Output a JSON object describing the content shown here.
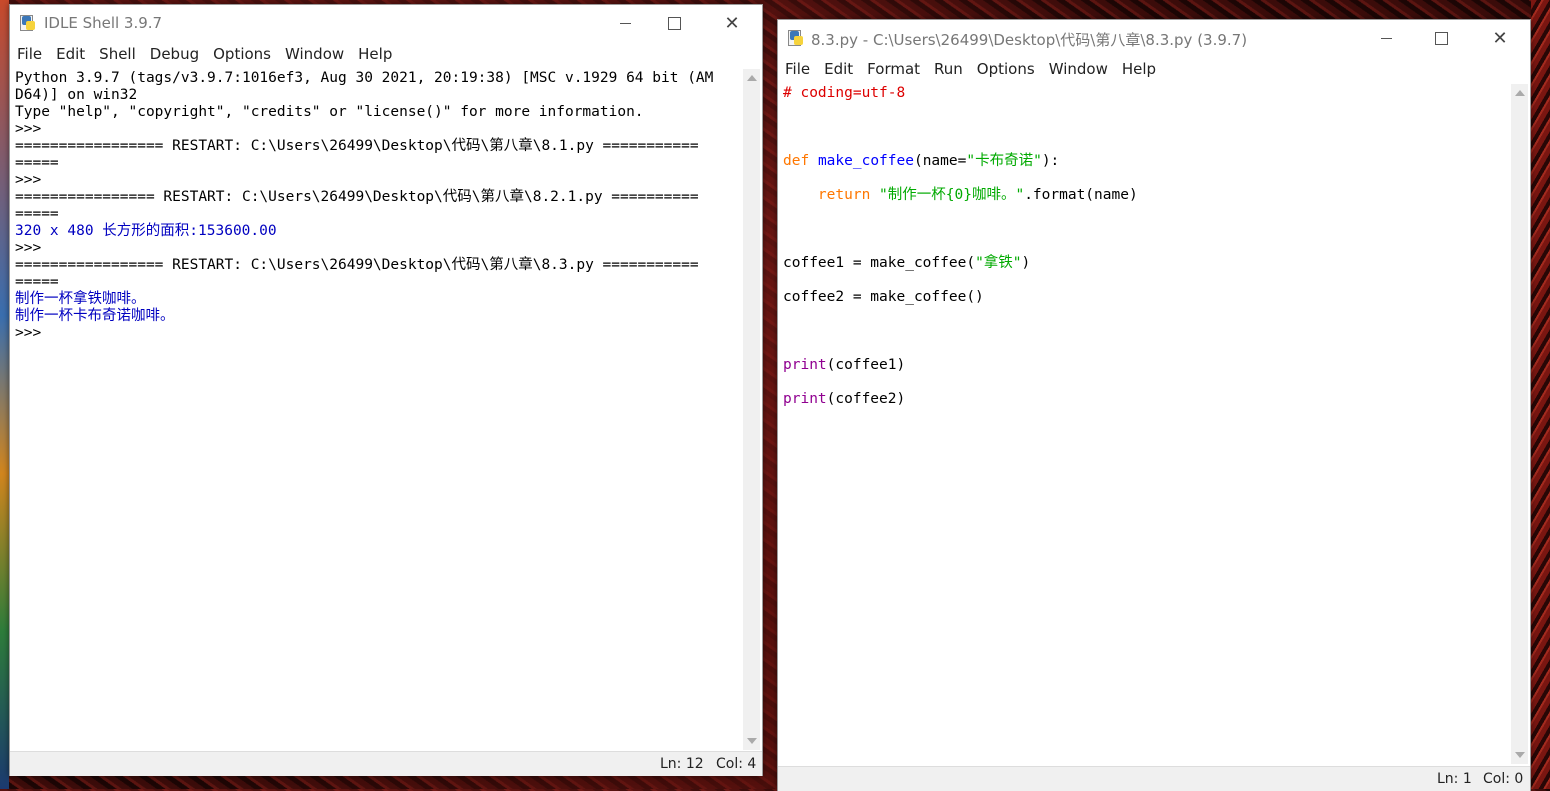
{
  "shell": {
    "title": "IDLE Shell 3.9.7",
    "menu": [
      "File",
      "Edit",
      "Shell",
      "Debug",
      "Options",
      "Window",
      "Help"
    ],
    "lines": [
      {
        "text": "Python 3.9.7 (tags/v3.9.7:1016ef3, Aug 30 2021, 20:19:38) [MSC v.1929 64 bit (AM",
        "kind": "normal"
      },
      {
        "text": "D64)] on win32",
        "kind": "normal"
      },
      {
        "text": "Type \"help\", \"copyright\", \"credits\" or \"license()\" for more information.",
        "kind": "normal"
      },
      {
        "text": ">>>",
        "kind": "normal"
      },
      {
        "text": "================= RESTART: C:\\Users\\26499\\Desktop\\代码\\第八章\\8.1.py ===========",
        "kind": "normal"
      },
      {
        "text": "=====",
        "kind": "normal"
      },
      {
        "text": ">>>",
        "kind": "normal"
      },
      {
        "text": "================ RESTART: C:\\Users\\26499\\Desktop\\代码\\第八章\\8.2.1.py ==========",
        "kind": "normal"
      },
      {
        "text": "=====",
        "kind": "normal"
      },
      {
        "text": "320 x 480 长方形的面积:153600.00",
        "kind": "output"
      },
      {
        "text": ">>>",
        "kind": "normal"
      },
      {
        "text": "================= RESTART: C:\\Users\\26499\\Desktop\\代码\\第八章\\8.3.py ===========",
        "kind": "normal"
      },
      {
        "text": "=====",
        "kind": "normal"
      },
      {
        "text": "制作一杯拿铁咖啡。",
        "kind": "output"
      },
      {
        "text": "制作一杯卡布奇诺咖啡。",
        "kind": "output"
      },
      {
        "text": ">>>",
        "kind": "normal"
      }
    ],
    "status_ln": "Ln: 12",
    "status_col": "Col: 4"
  },
  "editor": {
    "title": "8.3.py - C:\\Users\\26499\\Desktop\\代码\\第八章\\8.3.py (3.9.7)",
    "menu": [
      "File",
      "Edit",
      "Format",
      "Run",
      "Options",
      "Window",
      "Help"
    ],
    "code": {
      "l1_comment": "# coding=utf-8",
      "l3_kw": "def",
      "l3_fn": "make_coffee",
      "l3_a": "(name=",
      "l3_str": "\"卡布奇诺\"",
      "l3_b": "):",
      "l4_kw": "return",
      "l4_str": "\"制作一杯{0}咖啡。\"",
      "l4_b": ".format(name)",
      "l6_a": "coffee1 = make_coffee(",
      "l6_str": "\"拿铁\"",
      "l6_b": ")",
      "l7": "coffee2 = make_coffee()",
      "l9_bi": "print",
      "l9_b": "(coffee1)",
      "l10_bi": "print",
      "l10_b": "(coffee2)"
    },
    "status_ln": "Ln: 1",
    "status_col": "Col: 0"
  }
}
